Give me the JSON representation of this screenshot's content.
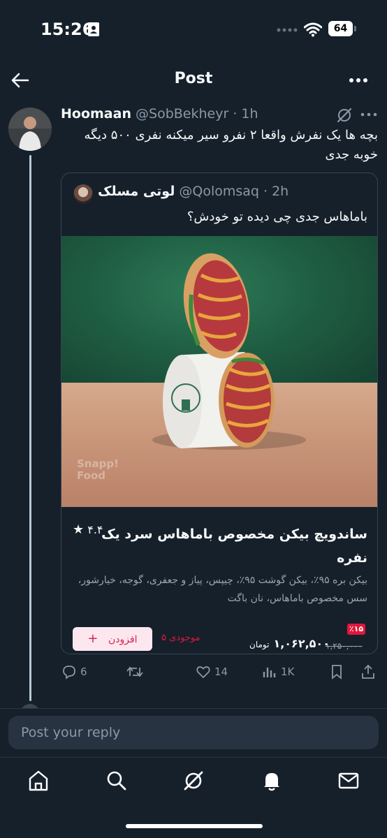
{
  "status_bar": {
    "time": "15:26",
    "battery": "64"
  },
  "header": {
    "title": "Post"
  },
  "tweet": {
    "display_name": "Hoomaan",
    "handle": "@SobBekheyr",
    "time": "· 1h",
    "text": "بچه ها یک نفرش واقعا ۲ نفرو سیر میکنه نفری ۵۰۰ دیگه خوبه جدی"
  },
  "quote": {
    "display_name": "لوتی مسلک",
    "handle": "@Qolomsaq",
    "time": "· 2h",
    "text": "باماهاس جدی چی دیده تو خودش؟",
    "image_watermark_line1": "Snapp!",
    "image_watermark_line2": "Food",
    "product": {
      "title": "ساندویچ بیکن مخصوص باماهاس سرد یک نفره",
      "rating": "۴.۴",
      "description": "بیکن بره ۹۵٪، بیکن گوشت ۹۵٪، چیپس، پیاز و جعفری، گوجه، خیارشور، سس مخصوص باماهاس، نان باگت",
      "discount": "٪۱۵",
      "old_price": "۱,۲۵۰,۰۰۰",
      "new_price": "۱,۰۶۲,۵۰۰",
      "currency": "تومان",
      "stock": "موجودی ۵",
      "add_label": "افزودن"
    }
  },
  "actions": {
    "replies": "6",
    "likes": "14",
    "views": "1K"
  },
  "reply": {
    "placeholder": "Post your reply"
  },
  "colors": {
    "background": "#15202b",
    "text": "#f7f9f9",
    "muted": "#8b98a5",
    "accent_red": "#e0173a"
  },
  "icons": {
    "header": [
      "back-arrow-icon",
      "more-icon"
    ],
    "actions": [
      "reply-icon",
      "repost-icon",
      "like-icon",
      "views-icon",
      "bookmark-icon",
      "share-icon"
    ],
    "nav": [
      "home-icon",
      "search-icon",
      "grok-icon",
      "notifications-icon",
      "messages-icon"
    ]
  }
}
